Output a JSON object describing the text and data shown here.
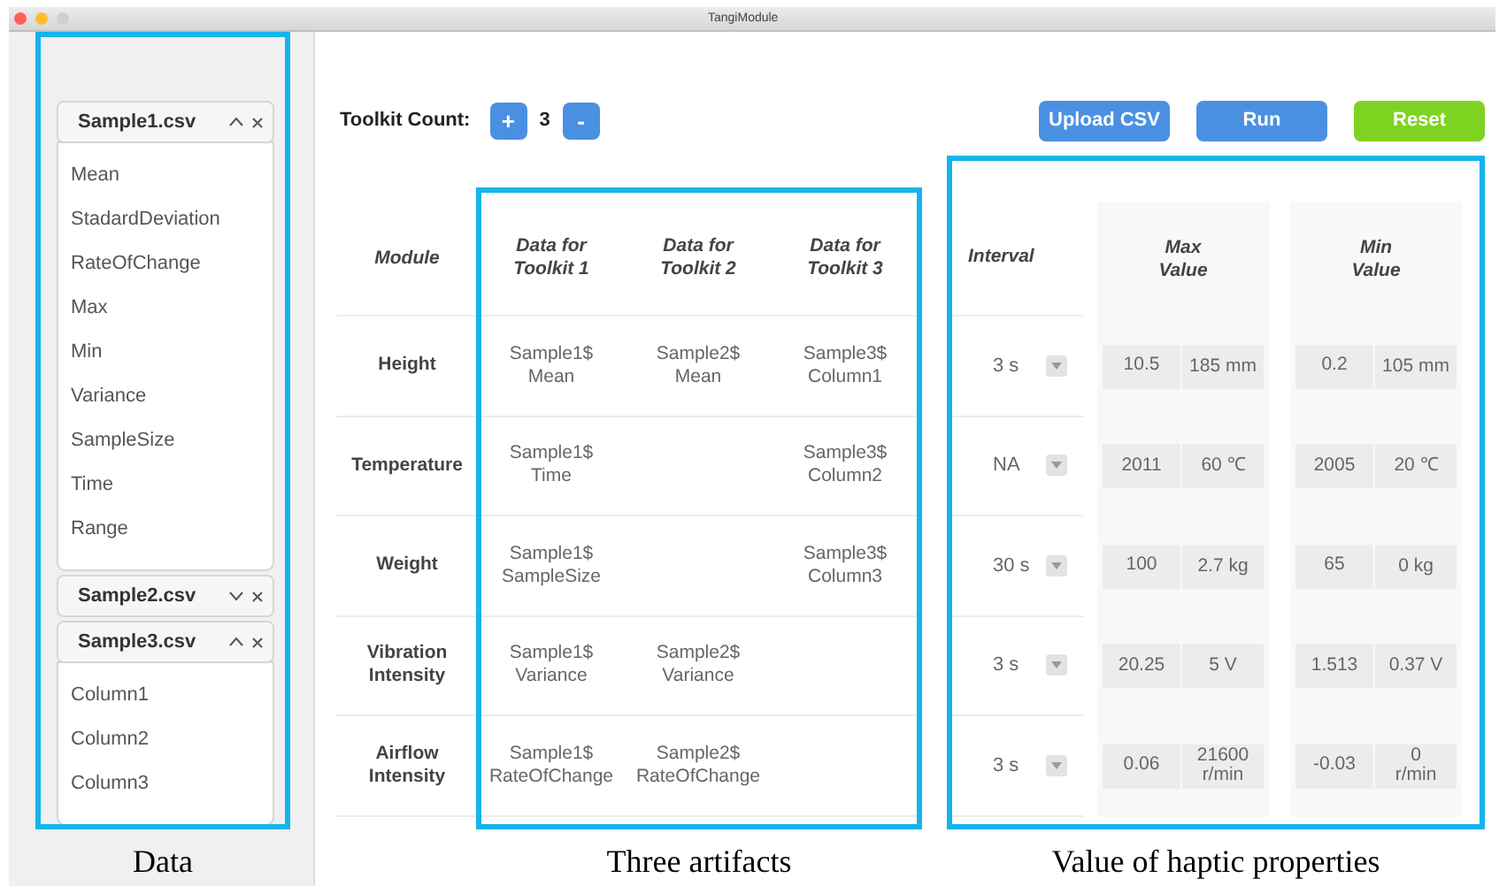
{
  "window": {
    "title": "TangiModule",
    "controls": [
      {
        "color": "#fe5f57"
      },
      {
        "color": "#febc2e"
      },
      {
        "color": "#d0d0d0"
      }
    ]
  },
  "sidebar": {
    "files": [
      {
        "name": "Sample1.csv",
        "expanded": true,
        "items": [
          "Mean",
          "StadardDeviation",
          "RateOfChange",
          "Max",
          "Min",
          "Variance",
          "SampleSize",
          "Time",
          "Range"
        ]
      },
      {
        "name": "Sample2.csv",
        "expanded": false
      },
      {
        "name": "Sample3.csv",
        "expanded": true,
        "items": [
          "Column1",
          "Column2",
          "Column3"
        ]
      }
    ]
  },
  "toolbar": {
    "label": "Toolkit Count:",
    "increment": "+",
    "count": "3",
    "decrement": "-",
    "buttons": [
      {
        "label": "Upload CSV",
        "color": "#4a90e2"
      },
      {
        "label": "Run",
        "color": "#4a90e2"
      },
      {
        "label": "Reset",
        "color": "#7ed321"
      }
    ]
  },
  "artifacts_table": {
    "columns": [
      "Module",
      "Data for\nToolkit 1",
      "Data for\nToolkit 2",
      "Data for\nToolkit 3"
    ],
    "rows": [
      {
        "cells": [
          "Height",
          "Sample1$\nMean",
          "Sample2$\nMean",
          "Sample3$\nColumn1"
        ]
      },
      {
        "cells": [
          "Temperature",
          "Sample1$\nTime",
          "",
          "Sample3$\nColumn2"
        ]
      },
      {
        "cells": [
          "Weight",
          "Sample1$\nSampleSize",
          "",
          "Sample3$\nColumn3"
        ]
      },
      {
        "cells": [
          "Vibration\nIntensity",
          "Sample1$\nVariance",
          "Sample2$\nVariance",
          ""
        ]
      },
      {
        "cells": [
          "Airflow\nIntensity",
          "Sample1$\nRateOfChange",
          "Sample2$\nRateOfChange",
          ""
        ]
      }
    ]
  },
  "properties_table": {
    "columns": [
      "Interval",
      "Max\nValue",
      "Min\nValue"
    ],
    "rows": [
      {
        "interval": "3 s",
        "max_value": "10.5",
        "max_unit": "185 mm",
        "min_value": "0.2",
        "min_unit": "105 mm"
      },
      {
        "interval": "NA",
        "max_value": "2011",
        "max_unit": "60 ℃",
        "min_value": "2005",
        "min_unit": "20 ℃"
      },
      {
        "interval": "30 s",
        "max_value": "100",
        "max_unit": "2.7 kg",
        "min_value": "65",
        "min_unit": "0 kg"
      },
      {
        "interval": "3 s",
        "max_value": "20.25",
        "max_unit": "5 V",
        "min_value": "1.513",
        "min_unit": "0.37 V"
      },
      {
        "interval": "3 s",
        "max_value": "0.06",
        "max_unit": "21600\nr/min",
        "min_value": "-0.03",
        "min_unit": "0\nr/min"
      }
    ]
  },
  "annotations": [
    {
      "label": "Data"
    },
    {
      "label": "Three artifacts"
    },
    {
      "label": "Value of haptic properties"
    }
  ]
}
